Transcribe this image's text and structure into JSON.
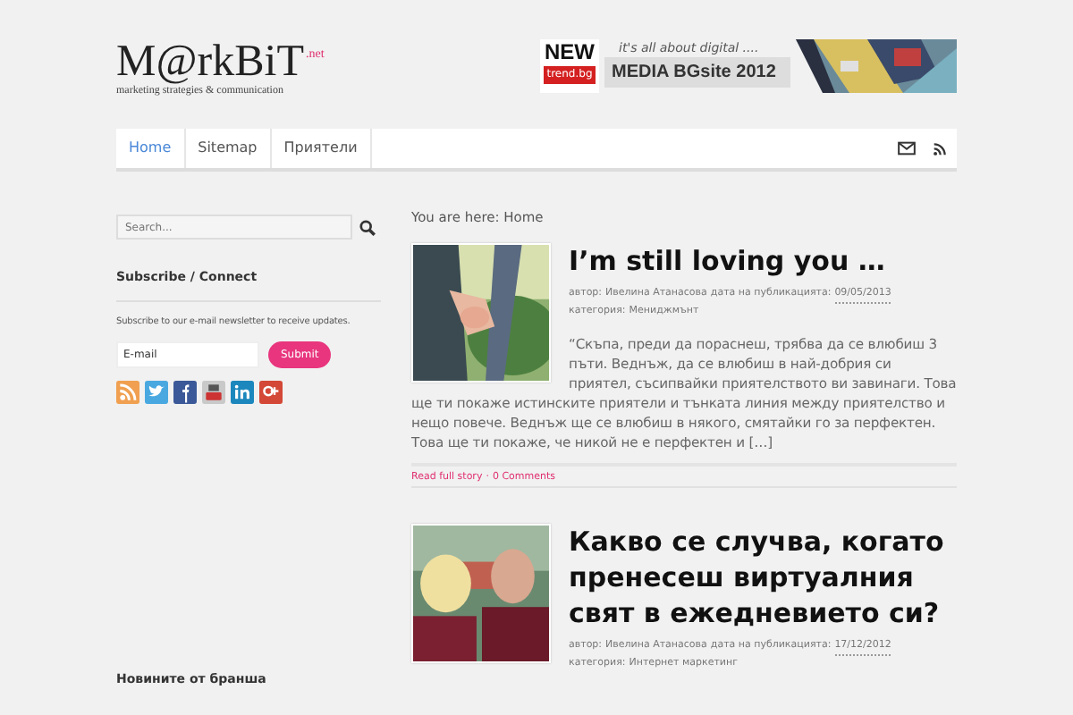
{
  "logo": {
    "name": "M@rkBiT",
    "suffix": ".net",
    "tagline": "marketing strategies & communication"
  },
  "banner": {
    "badge_top": "NEW",
    "badge_bottom": "trend.bg",
    "slogan": "it's all about digital ....",
    "title": "MEDIA BGsite 2012"
  },
  "nav": {
    "items": [
      {
        "label": "Home",
        "selected": true
      },
      {
        "label": "Sitemap",
        "selected": false
      },
      {
        "label": "Приятели",
        "selected": false
      }
    ]
  },
  "sidebar": {
    "search": {
      "placeholder": "Search..."
    },
    "subscribe": {
      "title": "Subscribe / Connect",
      "text": "Subscribe to our e-mail newsletter to receive updates.",
      "field": {
        "placeholder": "E-mail"
      },
      "button": "Submit"
    },
    "social": [
      {
        "kind": "rss",
        "color": "#f0a050"
      },
      {
        "kind": "twitter",
        "color": "#4aa8e0"
      },
      {
        "kind": "facebook",
        "color": "#3b5998"
      },
      {
        "kind": "youtube",
        "color": "#c9c9c9"
      },
      {
        "kind": "linkedin",
        "color": "#1c87bd"
      },
      {
        "kind": "gplus",
        "color": "#d34836"
      }
    ],
    "next_title": "Новините от бранша"
  },
  "breadcrumb": "You are here: Home",
  "posts": [
    {
      "title": "I’m still loving you …",
      "author_label": "автор:",
      "author": "Ивелина Атанасова",
      "date_label": "дата на публикацията:",
      "date": "09/05/2013",
      "category_label": "категория:",
      "category": "Мениджмънт",
      "excerpt": "“Скъпа, преди да пораснеш, трябва да се влюбиш 3 пъти. Веднъж, да се влюбиш в най-добрия си приятел, съсипвайки приятелството ви завинаги. Това ще ти покаже истинските приятели и тънката линия между приятелство и нещо повече. Веднъж ще се влюбиш в някого, смятайки го за перфектен. Това ще ти покаже, че никой не е перфектен и […]",
      "read_more": "Read full story",
      "separator": "·",
      "comments": "0 Comments"
    },
    {
      "title": "Какво се случва, когато пренесеш виртуалния свят в ежедневието си?",
      "author_label": "автор:",
      "author": "Ивелина Атанасова",
      "date_label": "дата на публикацията:",
      "date": "17/12/2012",
      "category_label": "категория:",
      "category": "Интернет маркетинг"
    }
  ]
}
